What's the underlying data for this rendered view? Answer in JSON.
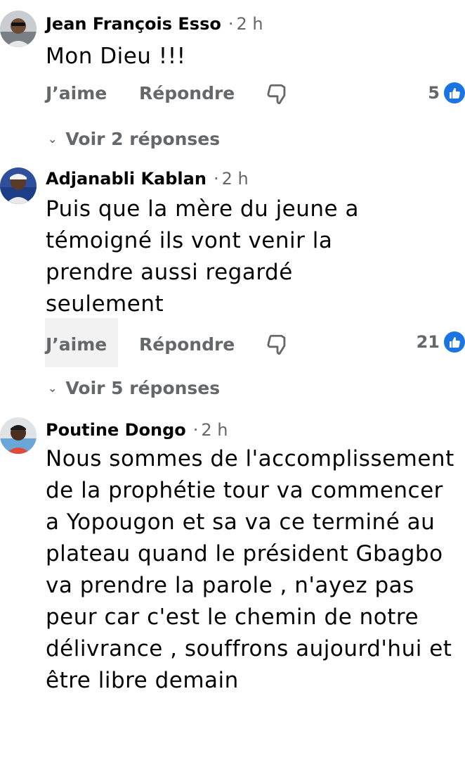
{
  "comments": [
    {
      "author": "Jean François Esso",
      "separator": "·",
      "time": "2 h",
      "text": "Mon Dieu !!!",
      "like_label": "J’aime",
      "reply_label": "Répondre",
      "reaction_count": "5",
      "replies_label": "Voir 2 réponses"
    },
    {
      "author": "Adjanabli Kablan",
      "separator": "·",
      "time": "2 h",
      "text": "Puis que la mère du jeune a témoigné ils vont venir la prendre aussi regardé seulement",
      "like_label": "J’aime",
      "reply_label": "Répondre",
      "reaction_count": "21",
      "replies_label": "Voir 5 réponses"
    },
    {
      "author": "Poutine Dongo",
      "separator": "·",
      "time": "2 h",
      "text": "Nous sommes de l'accomplissement de la prophétie tour va commencer a Yopougon et sa va ce terminé au plateau quand le président Gbagbo va prendre la parole , n'ayez pas peur car c'est le chemin de notre délivrance , souffrons aujourd'hui et être libre demain"
    }
  ],
  "colors": {
    "name": "#050505",
    "meta": "#65676b",
    "like_blue": "#1b74e4"
  },
  "icons": {
    "dislike": "thumbs-down-outline-icon",
    "like_reaction": "like-reaction-icon",
    "chevron": "chevron-down-icon"
  }
}
